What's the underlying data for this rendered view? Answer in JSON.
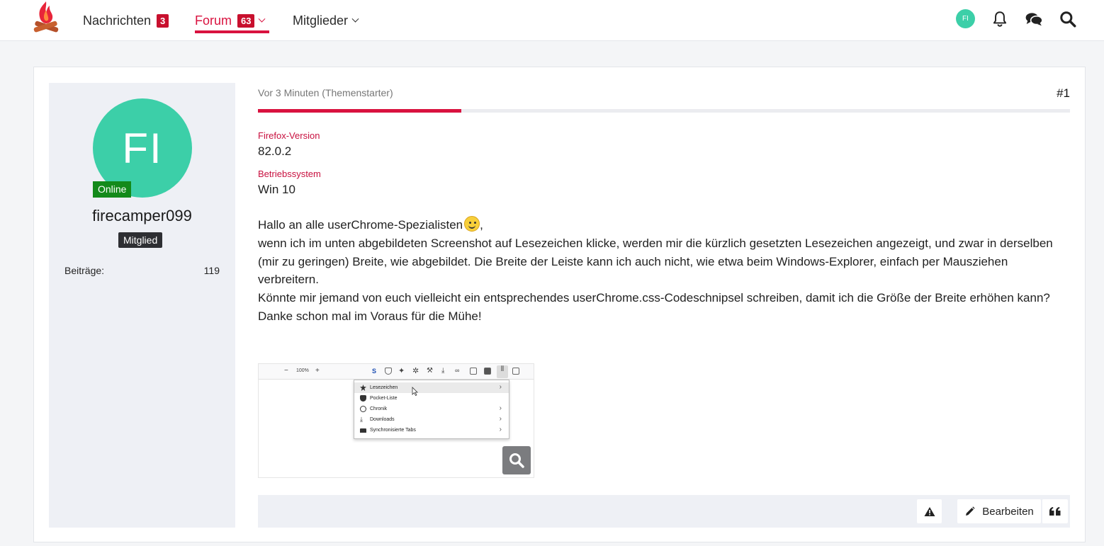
{
  "header": {
    "nav": [
      {
        "label": "Nachrichten",
        "badge": "3"
      },
      {
        "label": "Forum",
        "badge": "63"
      },
      {
        "label": "Mitglieder"
      }
    ],
    "user_initials": "FI",
    "icons": [
      "bell-icon",
      "chat-bubbles-icon",
      "search-icon"
    ],
    "accent_color": "#d9123f"
  },
  "author": {
    "initials": "FI",
    "status": "Online",
    "username": "firecamper099",
    "rank": "Mitglied",
    "stats": [
      {
        "label": "Beiträge",
        "value": "119"
      }
    ]
  },
  "post": {
    "time": "Vor 3 Minuten (Themenstarter)",
    "number": "#1",
    "read_progress_percent": 25,
    "fields": [
      {
        "label": "Firefox-Version",
        "value": "82.0.2"
      },
      {
        "label": "Betriebssystem",
        "value": "Win 10"
      }
    ],
    "body": {
      "greeting": "Hallo an alle userChrome-Spezialisten",
      "greeting_tail": ",",
      "line1": "wenn ich im unten abgebildeten Screenshot auf Lesezeichen klicke, werden mir die kürzlich gesetzten Lesezeichen angezeigt, und zwar in derselben (mir zu geringen) Breite, wie abgebildet. Die Breite der Leiste kann ich auch nicht, wie etwa beim Windows-Explorer, einfach per Mausziehen verbreitern.",
      "line2": "Könnte mir jemand von euch vielleicht ein entsprechendes userChrome.css-Codeschnipsel schreiben, damit ich die Größe der Breite erhöhen kann?",
      "line3": "Danke schon mal im Voraus für die Mühe!"
    },
    "attachment": {
      "zoom_text": "100%",
      "menu_items": [
        {
          "label": "Lesezeichen",
          "arrow": "›"
        },
        {
          "label": "Pocket-Liste",
          "arrow": ""
        },
        {
          "label": "Chronik",
          "arrow": "›"
        },
        {
          "label": "Downloads",
          "arrow": "›"
        },
        {
          "label": "Synchronisierte Tabs",
          "arrow": "›"
        }
      ]
    },
    "actions": {
      "edit_label": "Bearbeiten"
    }
  }
}
